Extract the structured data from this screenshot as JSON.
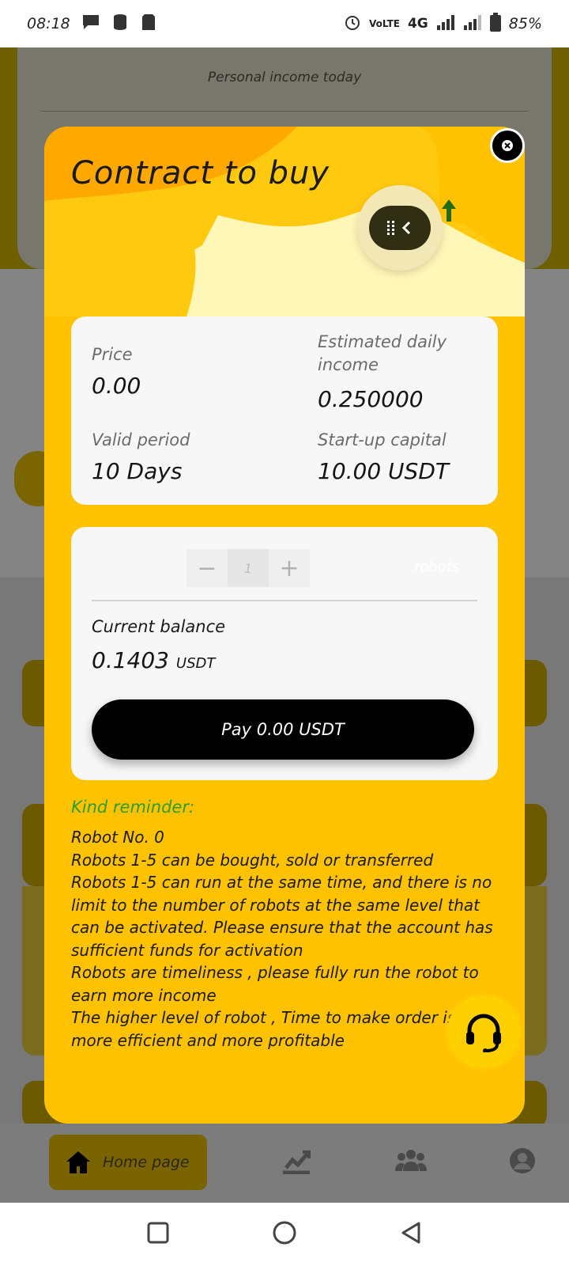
{
  "status_bar": {
    "time": "08:18",
    "battery": "85%",
    "network": "4G"
  },
  "background": {
    "personal_income_label": "Personal income today",
    "home_label": "Home page"
  },
  "modal": {
    "title": "Contract to buy",
    "info": {
      "price_label": "Price",
      "price_value": "0.00",
      "daily_income_label": "Estimated daily income",
      "daily_income_value": "0.250000",
      "period_label": "Valid period",
      "period_value": "10 Days",
      "capital_label": "Start-up capital",
      "capital_value": "10.00 USDT"
    },
    "quantity": {
      "minus": "−",
      "value": "1",
      "plus": "+",
      "unit": "robots"
    },
    "balance_label": "Current balance",
    "balance_value": "0.1403",
    "balance_unit": "USDT",
    "pay_label": "Pay 0.00 USDT",
    "reminder_title": "Kind reminder:",
    "reminder_lines": [
      "Robot No. 0",
      "Robots 1-5 can be bought, sold or transferred",
      "Robots 1-5 can run at the same time, and there is no limit to the number of robots at the same level that can be activated. Please ensure that the account has sufficient funds for activation",
      "Robots are timeliness , please fully run the robot to earn more income",
      "The higher level of robot , Time to make order is more efficient and more profitable"
    ]
  },
  "colors": {
    "modal_bg": "#ffc200",
    "accent_green": "#2e9d2e",
    "pay_button": "#000000"
  }
}
